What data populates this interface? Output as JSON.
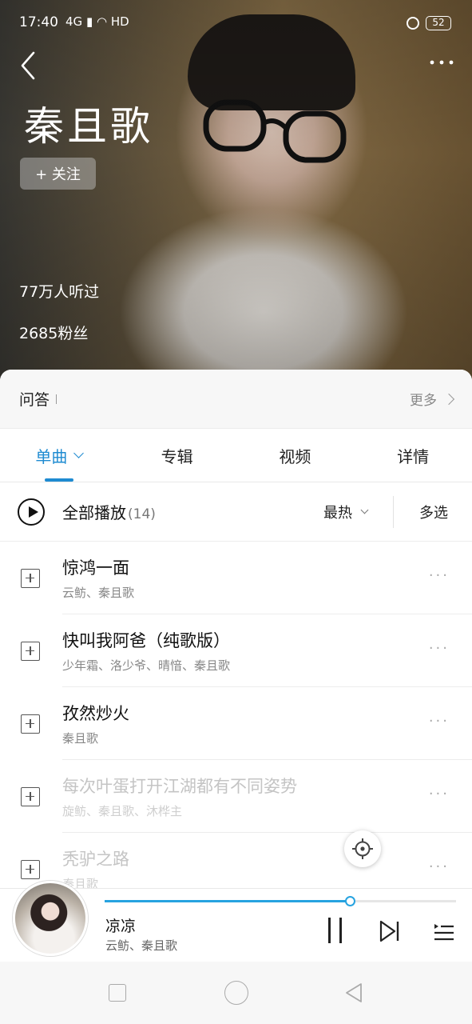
{
  "status_bar": {
    "time": "17:40",
    "network": "4G",
    "hd": "HD",
    "battery": "52"
  },
  "header": {
    "artist_name": "秦且歌",
    "follow_label": "+ 关注",
    "listeners": "77万人听过",
    "fans": "2685粉丝"
  },
  "qa": {
    "label": "问答",
    "more_label": "更多"
  },
  "tabs": [
    {
      "label": "单曲"
    },
    {
      "label": "专辑"
    },
    {
      "label": "视频"
    },
    {
      "label": "详情"
    }
  ],
  "playall": {
    "label": "全部播放",
    "count": "(14)",
    "sort_label": "最热",
    "multi_label": "多选"
  },
  "songs": [
    {
      "title": "惊鸿一面",
      "artists": "云鲂、秦且歌"
    },
    {
      "title": "快叫我阿爸（纯歌版）",
      "artists": "少年霜、洛少爷、晴愔、秦且歌"
    },
    {
      "title": "孜然炒火",
      "artists": "秦且歌"
    },
    {
      "title": "每次叶蛋打开江湖都有不同姿势",
      "artists": "旋鲂、秦且歌、沐桦主"
    },
    {
      "title": "秃驴之路",
      "artists": "秦且歌"
    }
  ],
  "now_playing": {
    "title": "凉凉",
    "artists": "云鲂、秦且歌",
    "progress": 0.7
  },
  "colors": {
    "accent": "#1e8bd1",
    "progress": "#27a3e0"
  }
}
